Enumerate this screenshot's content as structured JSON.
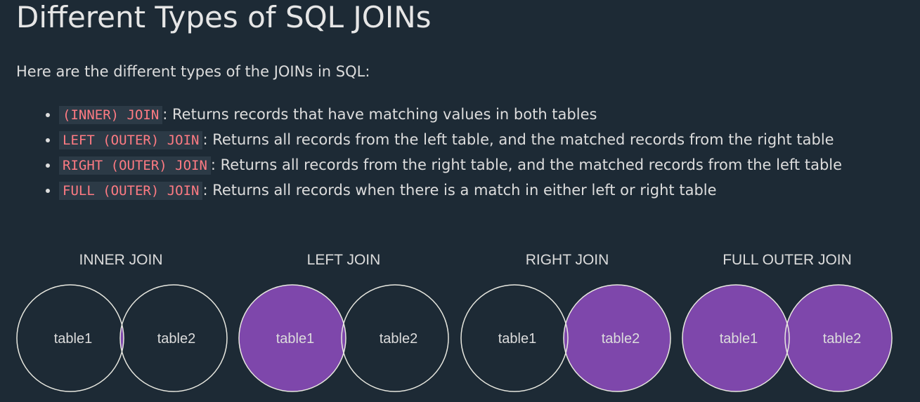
{
  "title": "Different Types of SQL JOINs",
  "intro": "Here are the different types of the JOINs in SQL:",
  "joins": [
    {
      "keyword": "(INNER) JOIN",
      "description": ": Returns records that have matching values in both tables"
    },
    {
      "keyword": "LEFT (OUTER) JOIN",
      "description": ": Returns all records from the left table, and the matched records from the right table"
    },
    {
      "keyword": "RIGHT (OUTER) JOIN",
      "description": ": Returns all records from the right table, and the matched records from the left table"
    },
    {
      "keyword": "FULL (OUTER) JOIN",
      "description": ": Returns all records when there is a match in either left or right table"
    }
  ],
  "diagrams": [
    {
      "title": "INNER JOIN",
      "left_label": "table1",
      "right_label": "table2"
    },
    {
      "title": "LEFT JOIN",
      "left_label": "table1",
      "right_label": "table2"
    },
    {
      "title": "RIGHT JOIN",
      "left_label": "table1",
      "right_label": "table2"
    },
    {
      "title": "FULL OUTER JOIN",
      "left_label": "table1",
      "right_label": "table2"
    }
  ],
  "colors": {
    "background": "#1d2a35",
    "keyword_text": "#ff7b83",
    "keyword_background": "#2c3a46",
    "fill": "#7e47ab",
    "stroke": "#e8e8e0"
  }
}
